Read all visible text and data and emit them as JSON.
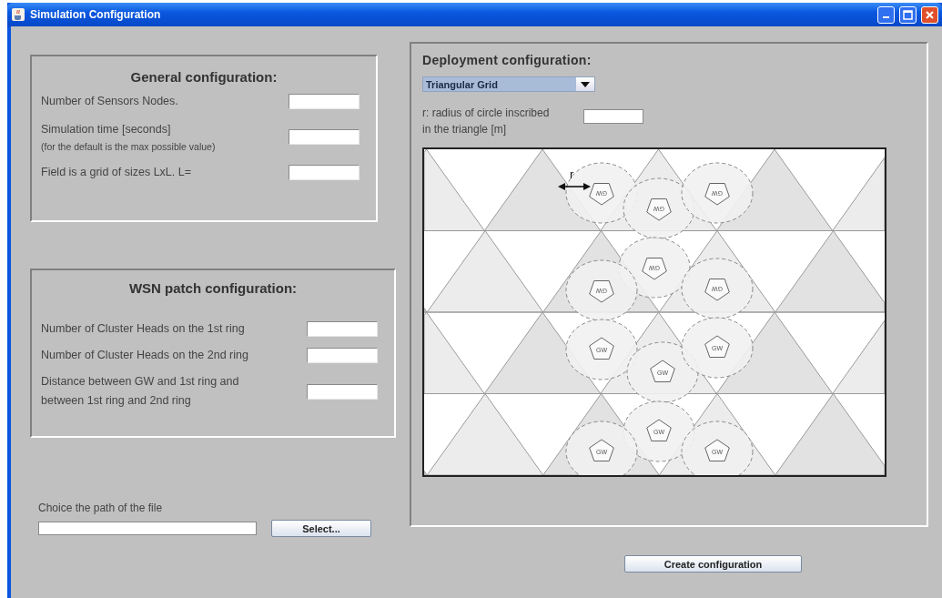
{
  "window": {
    "title": "Simulation Configuration"
  },
  "general": {
    "title": "General configuration:",
    "fields": [
      {
        "label_lines": [
          "Number of Sensors Nodes."
        ]
      },
      {
        "label_lines": [
          "Simulation time [seconds]"
        ],
        "note": "(for the default is the max possible value)"
      },
      {
        "label_lines": [
          "Field is a grid of sizes LxL. L="
        ]
      }
    ]
  },
  "wsn": {
    "title": "WSN patch configuration:",
    "fields": [
      {
        "label_lines": [
          "Number of Cluster Heads on the 1st ring"
        ]
      },
      {
        "label_lines": [
          "Number of Cluster Heads on the 2nd ring"
        ]
      },
      {
        "label_lines": [
          "Distance between GW and 1st ring and",
          "between 1st ring and 2nd ring"
        ]
      }
    ]
  },
  "deployment": {
    "title": "Deployment configuration:",
    "dropdown": {
      "value": "Triangular Grid"
    },
    "radius_field": {
      "label_lines": [
        "r: radius of  circle inscribed",
        "in the triangle [m]"
      ]
    },
    "diagram": {
      "radius_label": "r",
      "nodes": [
        {
          "label": "GW",
          "flipped": true
        },
        {
          "label": "GW",
          "flipped": true
        },
        {
          "label": "GW",
          "flipped": true
        },
        {
          "label": "GW",
          "flipped": true
        },
        {
          "label": "GW",
          "flipped": true
        },
        {
          "label": "GW",
          "flipped": true
        },
        {
          "label": "GW",
          "flipped": false
        },
        {
          "label": "GW",
          "flipped": false
        },
        {
          "label": "GW",
          "flipped": false
        },
        {
          "label": "GW",
          "flipped": false
        },
        {
          "label": "GW",
          "flipped": false
        },
        {
          "label": "GW",
          "flipped": false
        }
      ]
    }
  },
  "file": {
    "label": "Choice the path of the file",
    "button": "Select..."
  },
  "create_button": "Create configuration"
}
